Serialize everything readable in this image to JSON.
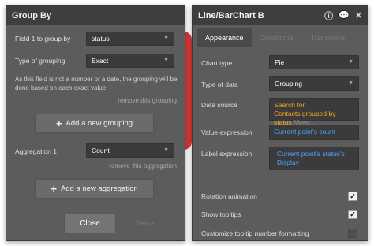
{
  "colors": {
    "panel_bg": "#5c5c5c",
    "header_bg": "#3e3e3e",
    "field_bg": "#3b3b3b",
    "orange_text": "#f5a623",
    "blue_text": "#4da3ff",
    "chart_red": "#d7393a"
  },
  "group_by": {
    "title": "Group By",
    "field_label": "Field 1 to group by",
    "field_value": "status",
    "type_label": "Type of grouping",
    "type_value": "Exact",
    "note": "As this field is not a number or a date, the grouping will be done based on each exact value.",
    "remove_grouping": "remove this grouping",
    "add_grouping": "Add a new grouping",
    "aggregation_label": "Aggregation 1",
    "aggregation_value": "Count",
    "remove_aggregation": "remove this aggregation",
    "add_aggregation": "Add a new aggregation",
    "close": "Close",
    "delete": "Delete"
  },
  "chart_panel": {
    "title": "Line/BarChart B",
    "icons": [
      "info-icon",
      "comment-icon",
      "close-icon"
    ],
    "tabs": [
      "Appearance",
      "Conditional",
      "Transitions"
    ],
    "chart_type_label": "Chart type",
    "chart_type_value": "Pie",
    "data_type_label": "Type of data",
    "data_type_value": "Grouping",
    "data_source_label": "Data source",
    "data_source_value": "Search for Contacts:grouped by status",
    "data_source_more": "More...",
    "value_expr_label": "Value expression",
    "value_expr_value": "Current point's count",
    "label_expr_label": "Label expression",
    "label_expr_value": "Current point's status's Display",
    "rotation_label": "Rotation animation",
    "rotation_checked": true,
    "tooltips_label": "Show tooltips",
    "tooltips_checked": true,
    "tooltip_format_label": "Customize tooltip number formatting",
    "tooltip_format_checked": false
  }
}
